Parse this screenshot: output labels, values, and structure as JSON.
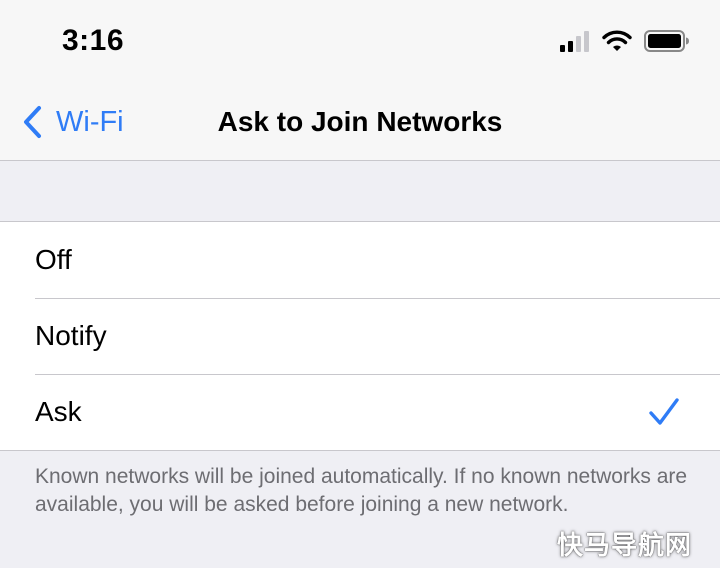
{
  "status_bar": {
    "time": "3:16",
    "icons": [
      "cellular-signal-icon",
      "wifi-icon",
      "battery-icon"
    ]
  },
  "nav": {
    "back_label": "Wi-Fi",
    "title": "Ask to Join Networks"
  },
  "options": [
    {
      "label": "Off",
      "selected": false
    },
    {
      "label": "Notify",
      "selected": false
    },
    {
      "label": "Ask",
      "selected": true
    }
  ],
  "footer": {
    "text": "Known networks will be joined automatically. If no known networks are available, you will be asked before joining a new network."
  },
  "watermark": "快马导航网",
  "colors": {
    "accent": "#2f7cf6",
    "background": "#efeff4",
    "cell": "#ffffff",
    "separator": "#c8c7cc",
    "footer_text": "#6d6d72"
  }
}
